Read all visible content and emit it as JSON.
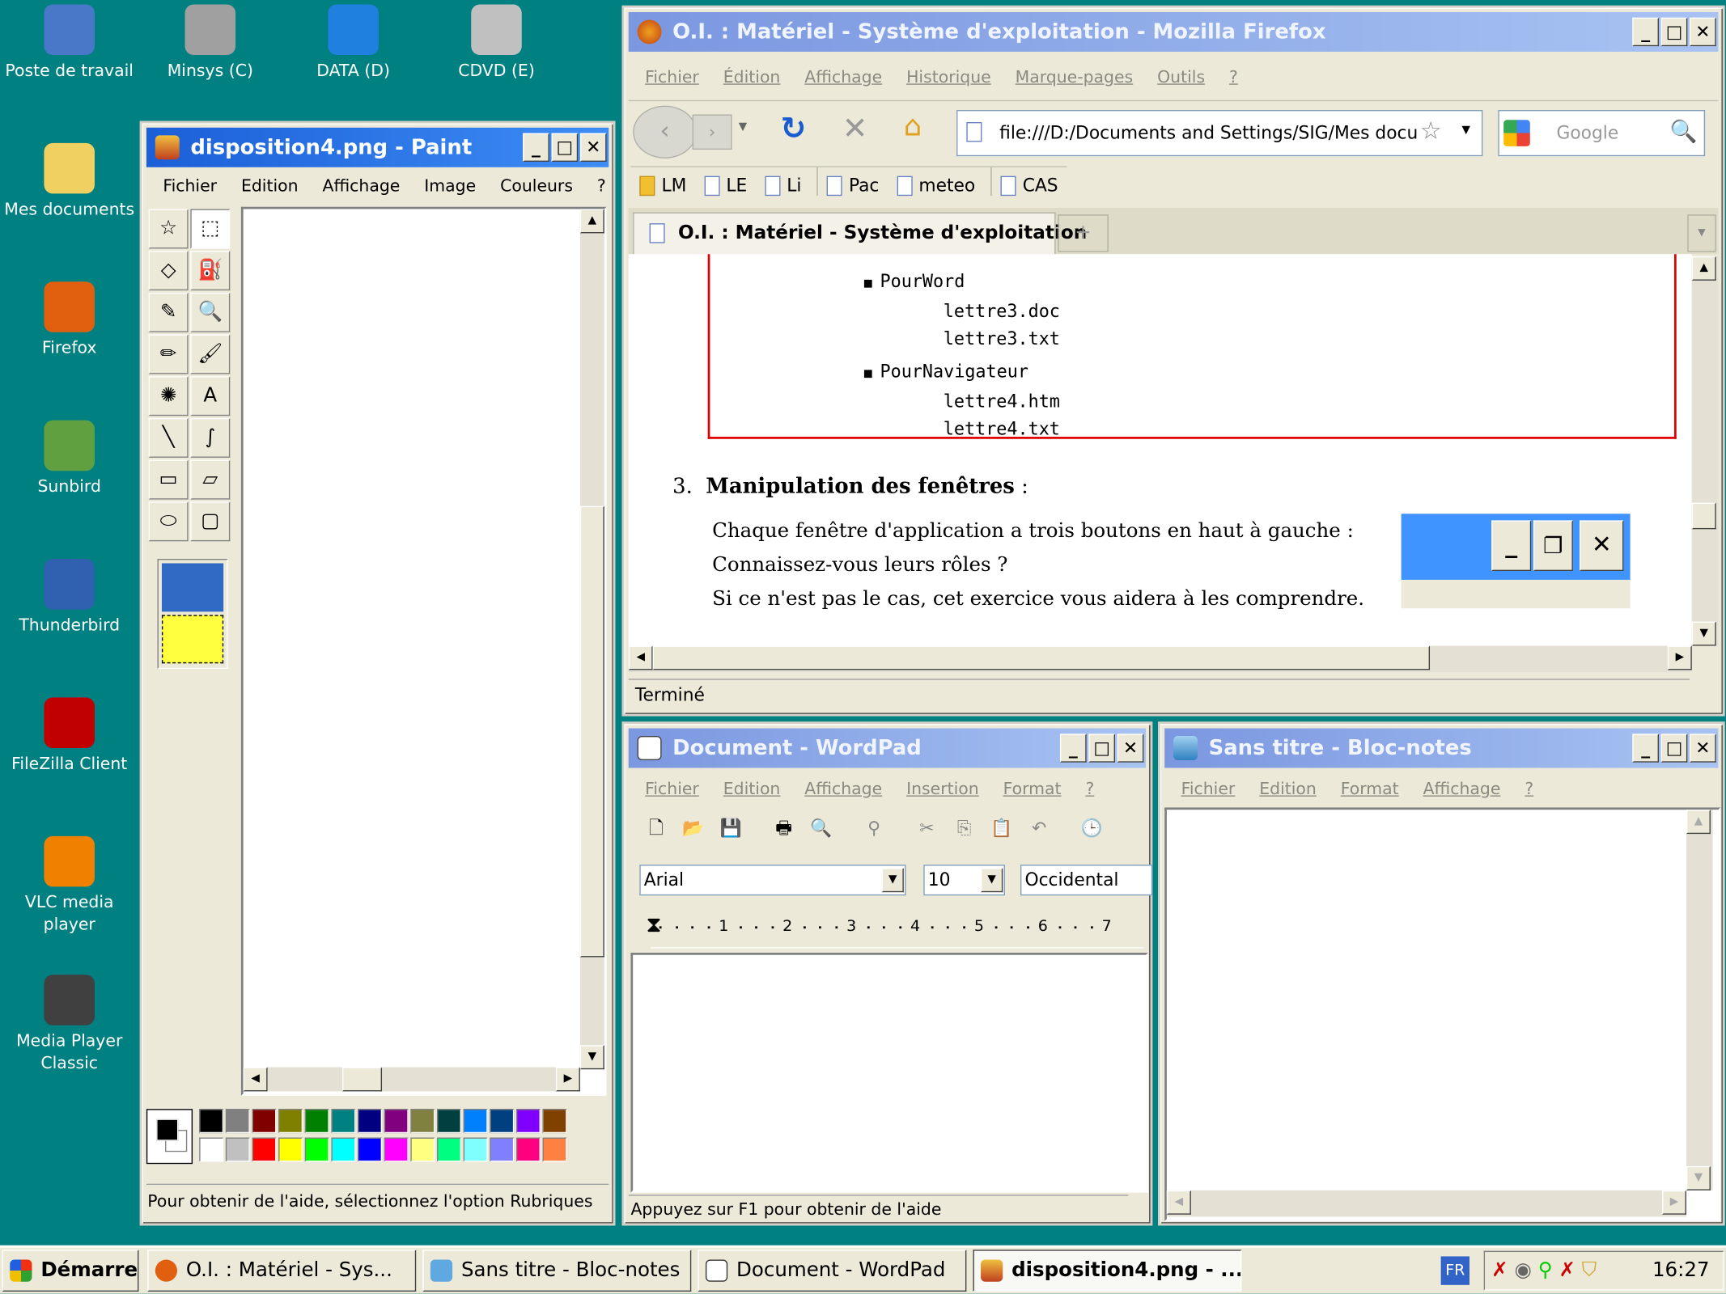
{
  "desktop": {
    "icons": [
      {
        "label": "Poste de travail",
        "color": "#4a78c8"
      },
      {
        "label": "Minsys (C)",
        "color": "#a0a0a0"
      },
      {
        "label": "DATA (D)",
        "color": "#2080e0"
      },
      {
        "label": "CDVD (E)",
        "color": "#c0c0c0"
      },
      {
        "label": "Mes documents",
        "color": "#f0d060"
      },
      {
        "label": "Firefox",
        "color": "#e06010"
      },
      {
        "label": "Sunbird",
        "color": "#60a040"
      },
      {
        "label": "Thunderbird",
        "color": "#3060b0"
      },
      {
        "label": "FileZilla Client",
        "color": "#c00000"
      },
      {
        "label": "VLC media player",
        "color": "#f08000"
      },
      {
        "label": "Media Player Classic",
        "color": "#404040"
      }
    ]
  },
  "paint": {
    "title": "disposition4.png - Paint",
    "menu": [
      "Fichier",
      "Edition",
      "Affichage",
      "Image",
      "Couleurs",
      "?"
    ],
    "tools": [
      "☆",
      "⬚",
      "◇",
      "⛽",
      "✎",
      "🔍",
      "✏",
      "🖌",
      "✺",
      "A",
      "╲",
      "∫",
      "▭",
      "▱",
      "⬭",
      "▢"
    ],
    "palette_top": [
      "#000000",
      "#808080",
      "#800000",
      "#808000",
      "#008000",
      "#008080",
      "#000080",
      "#800080",
      "#808040",
      "#004040",
      "#0080ff",
      "#004080",
      "#8000ff",
      "#804000"
    ],
    "palette_bottom": [
      "#ffffff",
      "#c0c0c0",
      "#ff0000",
      "#ffff00",
      "#00ff00",
      "#00ffff",
      "#0000ff",
      "#ff00ff",
      "#ffff80",
      "#00ff80",
      "#80ffff",
      "#8080ff",
      "#ff0080",
      "#ff8040"
    ],
    "foreground": "#000000",
    "background": "#ffffff",
    "status": "Pour obtenir de l'aide, sélectionnez l'option Rubriques"
  },
  "firefox": {
    "title": "O.I. : Matériel - Système d'exploitation - Mozilla Firefox",
    "menu": [
      "Fichier",
      "Édition",
      "Affichage",
      "Historique",
      "Marque-pages",
      "Outils",
      "?"
    ],
    "url": "file:///D:/Documents and Settings/SIG/Mes docum",
    "search_placeholder": "Google",
    "bookmarks": [
      "LM",
      "LE",
      "Li",
      "Pac",
      "meteo",
      "CAS"
    ],
    "tab": "O.I. : Matériel - Système d'exploitation",
    "tab_new": "+",
    "content": {
      "items": [
        {
          "name": "PourWord",
          "files": [
            "lettre3.doc",
            "lettre3.txt"
          ]
        },
        {
          "name": "PourNavigateur",
          "files": [
            "lettre4.htm",
            "lettre4.txt"
          ]
        }
      ],
      "section_num": "3.",
      "section_title": "Manipulation des fenêtres",
      "section_colon": " :",
      "lines": [
        "Chaque fenêtre d'application a trois boutons en haut à gauche :",
        "Connaissez-vous leurs rôles ?",
        "Si ce n'est pas le cas, cet exercice vous aidera à les comprendre."
      ]
    },
    "status": "Terminé"
  },
  "wordpad": {
    "title": "Document - WordPad",
    "menu": [
      "Fichier",
      "Edition",
      "Affichage",
      "Insertion",
      "Format",
      "?"
    ],
    "font": "Arial",
    "size": "10",
    "script": "Occidental",
    "ruler": [
      "1",
      "2",
      "3",
      "4",
      "5",
      "6",
      "7"
    ],
    "status": "Appuyez sur F1 pour obtenir de l'aide"
  },
  "notepad": {
    "title": "Sans titre - Bloc-notes",
    "menu": [
      "Fichier",
      "Edition",
      "Format",
      "Affichage",
      "?"
    ]
  },
  "taskbar": {
    "start": "Démarrer",
    "items": [
      "O.I. : Matériel - Sys...",
      "Sans titre - Bloc-notes",
      "Document - WordPad",
      "disposition4.png - ..."
    ],
    "lang": "FR",
    "clock": "16:27"
  }
}
